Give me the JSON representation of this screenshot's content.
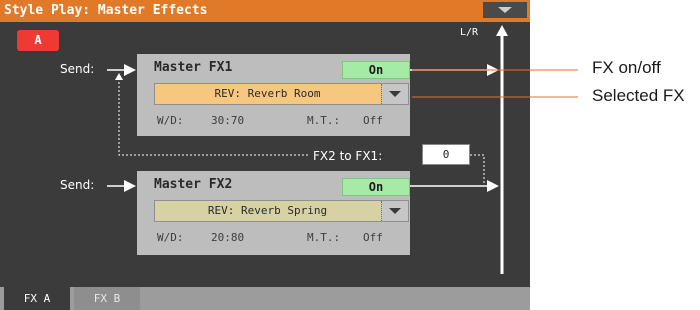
{
  "window": {
    "title": "Style Play: Master Effects"
  },
  "header": {
    "a_button_label": "A",
    "lr_label": "L/R"
  },
  "fx1": {
    "send_label": "Send:",
    "title": "Master FX1",
    "on_label": "On",
    "effect": "REV: Reverb Room",
    "wd_label": "W/D:",
    "wd_value": "30:70",
    "mt_label": "M.T.:",
    "mt_value": "Off",
    "select_color": "#f7c780"
  },
  "fx2": {
    "send_label": "Send:",
    "title": "Master FX2",
    "on_label": "On",
    "effect": "REV: Reverb Spring",
    "wd_label": "W/D:",
    "wd_value": "20:80",
    "mt_label": "M.T.:",
    "mt_value": "Off",
    "select_color": "#d7d2a4"
  },
  "routing": {
    "fx2_to_fx1_label": "FX2 to FX1:",
    "fx2_to_fx1_value": "0"
  },
  "tabs": [
    {
      "label": "FX A",
      "active": true
    },
    {
      "label": "FX B",
      "active": false
    }
  ],
  "callouts": {
    "on_off": "FX on/off",
    "selected": "Selected FX"
  },
  "colors": {
    "accent": "#e07a28",
    "on_green": "#a5eaa5",
    "a_red": "#ee3a33"
  }
}
